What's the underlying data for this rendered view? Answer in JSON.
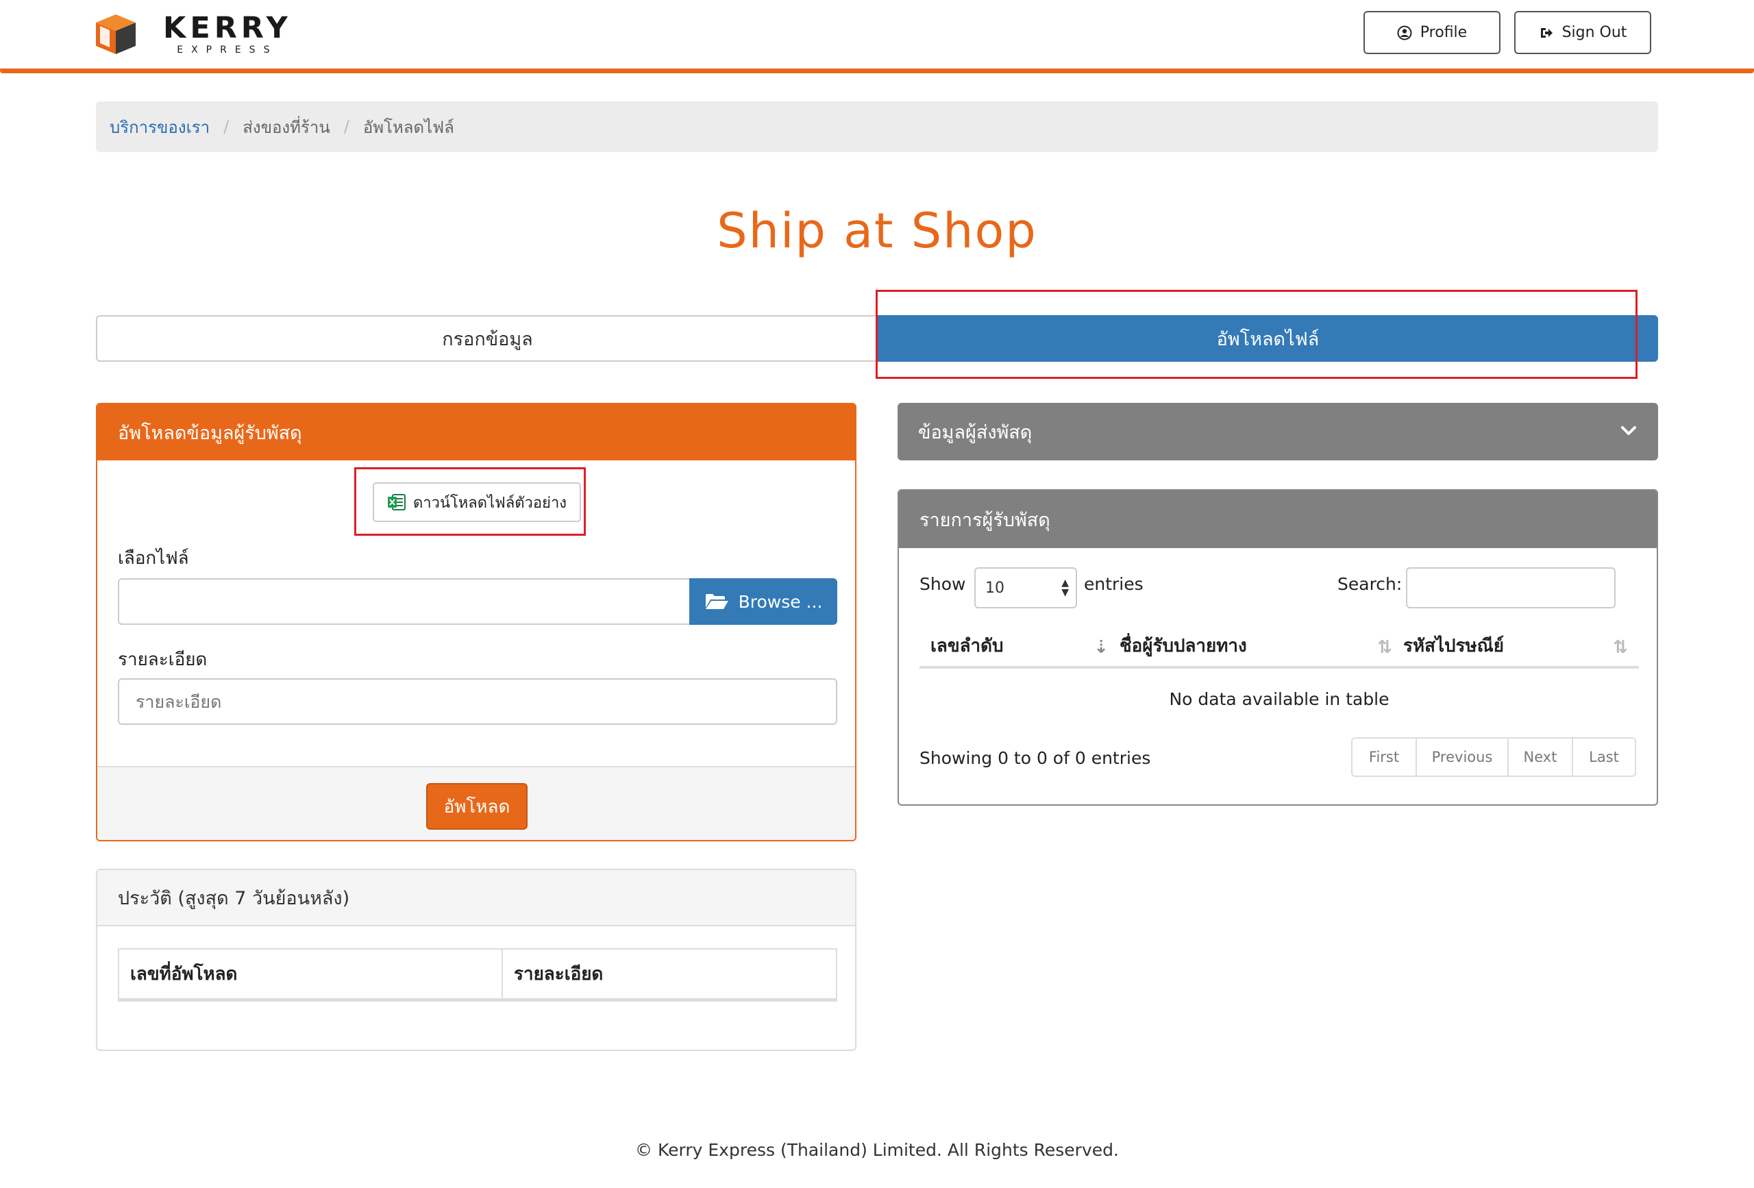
{
  "header": {
    "logo_word": "KERRY",
    "logo_sub": "EXPRESS",
    "profile_label": "Profile",
    "signout_label": "Sign Out",
    "accent_color": "#e8681a"
  },
  "breadcrumb": {
    "items": [
      "บริการของเรา",
      "ส่งของที่ร้าน",
      "อัพโหลดไฟล์"
    ]
  },
  "page_title": "Ship at Shop",
  "tabs": [
    {
      "label": "กรอกข้อมูล",
      "active": false
    },
    {
      "label": "อัพโหลดไฟล์",
      "active": true
    }
  ],
  "upload_panel": {
    "title": "อัพโหลดข้อมูลผู้รับพัสดุ",
    "download_sample_label": "ดาวน์โหลดไฟล์ตัวอย่าง",
    "file_label": "เลือกไฟล์",
    "browse_label": "Browse ...",
    "detail_label": "รายละเอียด",
    "detail_placeholder": "รายละเอียด",
    "submit_label": "อัพโหลด"
  },
  "history_panel": {
    "title": "ประวัติ (สูงสุด 7 วันย้อนหลัง)",
    "columns": [
      "เลขที่อัพโหลด",
      "รายละเอียด"
    ]
  },
  "sender_panel": {
    "title": "ข้อมูลผู้ส่งพัสดุ"
  },
  "list_panel": {
    "title": "รายการผู้รับพัสดุ",
    "show_label": "Show",
    "page_size": "10",
    "entries_label": "entries",
    "search_label": "Search:",
    "columns": [
      "เลขลำดับ",
      "ชื่อผู้รับปลายทาง",
      "รหัสไปรษณีย์"
    ],
    "empty_text": "No data available in table",
    "showing_text": "Showing 0 to 0 of 0 entries",
    "pager": [
      "First",
      "Previous",
      "Next",
      "Last"
    ]
  },
  "footer": {
    "text": "© Kerry Express (Thailand) Limited. All Rights Reserved."
  }
}
